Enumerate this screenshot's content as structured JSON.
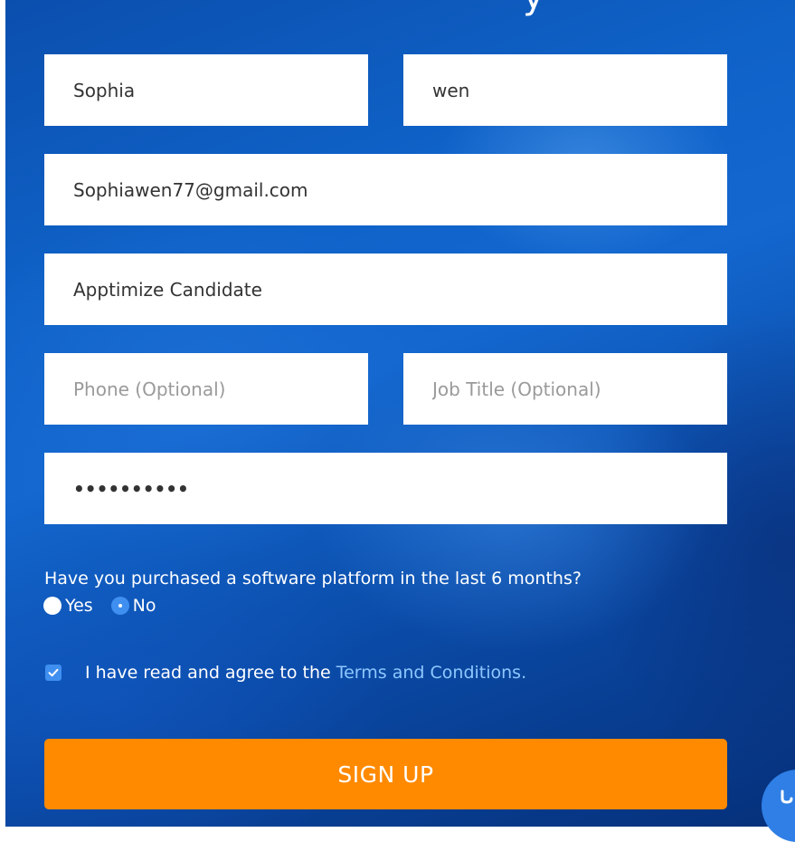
{
  "headline_fragment": "y",
  "form": {
    "first_name": {
      "value": "Sophia",
      "placeholder": ""
    },
    "last_name": {
      "value": "wen",
      "placeholder": ""
    },
    "email": {
      "value": "Sophiawen77@gmail.com",
      "placeholder": ""
    },
    "company": {
      "value": "Apptimize Candidate",
      "placeholder": ""
    },
    "phone": {
      "value": "",
      "placeholder": "Phone (Optional)"
    },
    "job_title": {
      "value": "",
      "placeholder": "Job Title (Optional)"
    },
    "password": {
      "value": "••••••••••",
      "placeholder": ""
    }
  },
  "purchase_question": {
    "label": "Have you purchased a software platform in the last 6 months?",
    "options": [
      {
        "label": "Yes",
        "selected": false
      },
      {
        "label": "No",
        "selected": true
      }
    ]
  },
  "terms": {
    "checked": true,
    "prefix": "I have read and agree to the",
    "link_text": "Terms and Conditions."
  },
  "submit": {
    "label": "SIGN UP"
  },
  "icons": {
    "checkbox_check": "check-icon",
    "chat": "chat-bubble-icon"
  },
  "colors": {
    "button": "#ff8a00",
    "accent": "#3f8ff0",
    "link": "#8ec7ff",
    "background": "#0f62c8"
  }
}
